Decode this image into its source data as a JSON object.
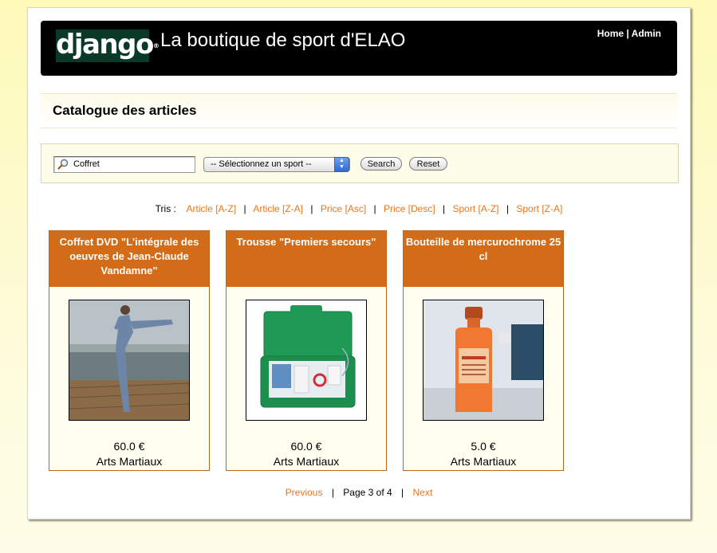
{
  "header": {
    "logo_text": "django",
    "logo_mark": "®",
    "title": "La boutique de sport d'ELAO",
    "links": {
      "home": "Home",
      "separator": " | ",
      "admin": "Admin"
    }
  },
  "catalog": {
    "title": "Catalogue des articles"
  },
  "search": {
    "value": "Coffret",
    "sport_select": "-- Sélectionnez un sport --",
    "search_button": "Search",
    "reset_button": "Reset"
  },
  "sort": {
    "label": "Tris :",
    "options": [
      "Article [A-Z]",
      "Article [Z-A]",
      "Price [Asc]",
      "Price [Desc]",
      "Sport [A-Z]",
      "Sport [Z-A]"
    ],
    "separator": "|"
  },
  "products": [
    {
      "title": "Coffret DVD \"L'intégrale des oeuvres de Jean-Claude Vandamne\"",
      "price": "60.0 €",
      "category": "Arts Martiaux"
    },
    {
      "title": "Trousse \"Premiers secours\"",
      "price": "60.0 €",
      "category": "Arts Martiaux"
    },
    {
      "title": "Bouteille de mercurochrome 25 cl",
      "price": "5.0 €",
      "category": "Arts Martiaux"
    }
  ],
  "pager": {
    "previous": "Previous",
    "status": "Page 3 of 4",
    "next": "Next",
    "separator": "|"
  },
  "colors": {
    "accent": "#d36c18",
    "link": "#e8761e",
    "header_bg": "#000000",
    "logo_bg": "#0a3a27"
  }
}
